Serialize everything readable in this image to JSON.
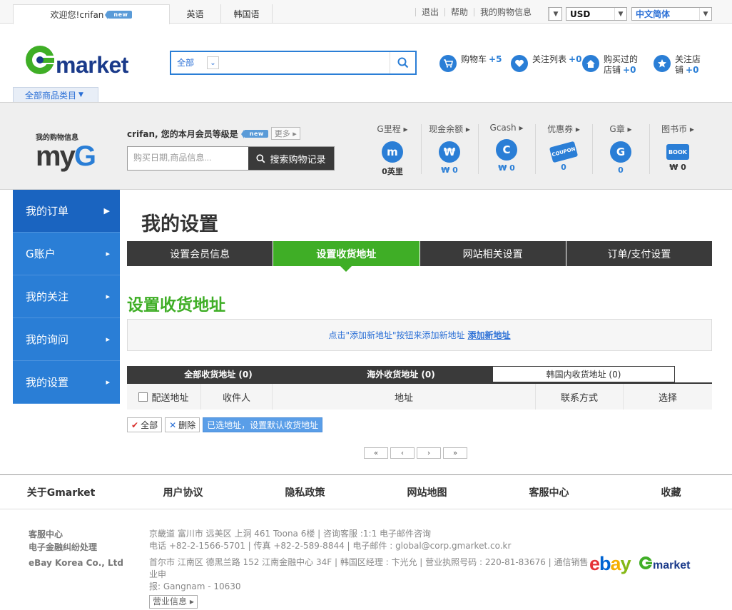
{
  "topbar": {
    "welcome": "欢迎您!",
    "username": "crifan",
    "new_badge": "new",
    "lang_tabs": [
      "英语",
      "韩国语"
    ],
    "links": [
      "退出",
      "帮助",
      "我的购物信息"
    ],
    "currency": "USD",
    "language": "中文简体"
  },
  "header": {
    "logo_text": "GMARKET",
    "search_category": "全部",
    "search_value": "",
    "icons": {
      "cart": {
        "label": "购物车",
        "count": "+5"
      },
      "watch": {
        "label": "关注列表",
        "count": "+0"
      },
      "bought1": "购买过的",
      "bought2": "店铺",
      "bought_count": "+0",
      "fav1": "关注店",
      "fav2": "铺",
      "fav_count": "+0"
    },
    "all_categories": "全部商品类目"
  },
  "myg": {
    "logo_small": "我的购物信息",
    "logo_big_my": "my",
    "logo_big_g": "G",
    "grade_text": "crifan, 您的本月会员等级是",
    "more": "更多",
    "search_placeholder": "购买日期,商品信息...",
    "search_button": "搜索购物记录",
    "stats": [
      {
        "label": "G里程",
        "icon": "m",
        "value": "0英里"
      },
      {
        "label": "现金余额",
        "icon": "₩",
        "value": "₩ 0"
      },
      {
        "label": "Gcash",
        "icon": "C",
        "value": "₩ 0"
      },
      {
        "label": "优惠券",
        "icon": "COUPON",
        "value": "0"
      },
      {
        "label": "G章",
        "icon": "G",
        "value": "0"
      },
      {
        "label": "图书币",
        "icon": "BOOK",
        "value": "₩ 0"
      }
    ]
  },
  "leftnav": [
    "我的订单",
    "G账户",
    "我的关注",
    "我的询问",
    "我的设置"
  ],
  "main": {
    "page_title": "我的设置",
    "tabs": [
      "设置会员信息",
      "设置收货地址",
      "网站相关设置",
      "订单/支付设置"
    ],
    "section_title": "设置收货地址",
    "info_text": "点击\"添加新地址\"按钮来添加新地址",
    "info_link": "添加新地址",
    "subtabs": [
      "全部收货地址 (0)",
      "海外收货地址 (0)",
      "韩国内收货地址 (0)"
    ],
    "table_headers": [
      "配送地址",
      "收件人",
      "地址",
      "联系方式",
      "选择"
    ],
    "actions": {
      "all": "全部",
      "delete": "删除",
      "set_default": "已选地址，设置默认收货地址"
    },
    "pager": [
      "«",
      "‹",
      "›",
      "»"
    ]
  },
  "footer": {
    "nav": [
      "关于Gmarket",
      "用户协议",
      "隐私政策",
      "网站地图",
      "客服中心",
      "收藏"
    ],
    "left1": "客服中心",
    "left2": "电子金融纠纷处理",
    "left3": "eBay Korea Co., Ltd",
    "line1": "京畿道 富川市 远美区 上洞 461 Toona 6楼 | 咨询客服 :1:1 电子邮件咨询",
    "line2": "电话 +82-2-1566-5701 | 传真 +82-2-589-8844 | 电子邮件 : global@corp.gmarket.co.kr",
    "line3": "首尔市 江南区 德黑兰路 152 江南金融中心 34F | 韩国区经理 : 卞光允 | 营业执照号码 : 220-81-83676 | 通信销售业申",
    "line4": "报: Gangnam - 10630",
    "biz_info": "营业信息",
    "ebay": "ebay",
    "gmarket": "GMARKET"
  }
}
